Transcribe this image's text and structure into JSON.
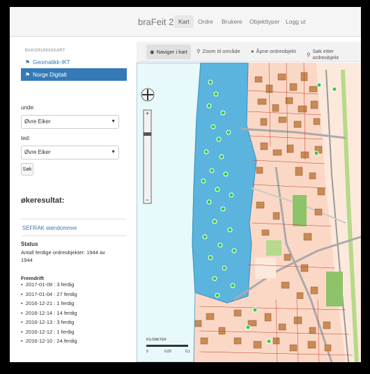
{
  "app": {
    "brand": "braFeit 2"
  },
  "nav": {
    "items": [
      "Kart",
      "Ordre",
      "Brukere",
      "Objekttyper",
      "Logg ut"
    ]
  },
  "sidebar": {
    "header": "BAKGRUNNSKART",
    "layers": [
      "Geomatikk-IKT",
      "Norge Digitalt"
    ],
    "kommune_label": "unde:",
    "kommune_value": "Øvre Eiker",
    "sted_label": "ted:",
    "sted_value": "Øvre Eiker",
    "search_button": "Søk"
  },
  "results": {
    "title": "økeresultat:",
    "layer_link": "SEFRAK eiendommer",
    "status_label": "Status",
    "status_text_1": "Antall ferdige ordreobjekter: 1944 av",
    "status_text_2": "1944",
    "progress_label": "Fremdrift",
    "progress_items": [
      "2017-01-09 : 3 ferdig",
      "2017-01-04 : 27 ferdig",
      "2016-12-21 : 1 ferdig",
      "2016-12-14 : 14 ferdig",
      "2016-12-13 : 3 ferdig",
      "2016-12-12 : 1 ferdig",
      "2016-12-10 : 24 ferdig"
    ]
  },
  "map_tabs": [
    "Naviger i kart",
    "Zoom til område",
    "Åpne ordreobjekt",
    "Søk etter ordreobjekt"
  ],
  "map": {
    "scale_label": "KILOMETER",
    "scale_ticks": [
      "0",
      "0,05",
      "0,1"
    ]
  },
  "colors": {
    "selected_area": "#5bb4dd",
    "land": "#fbd8c6",
    "water": "#e8f9fb",
    "buildings": "#c98a55",
    "points": "#2ecc40"
  }
}
